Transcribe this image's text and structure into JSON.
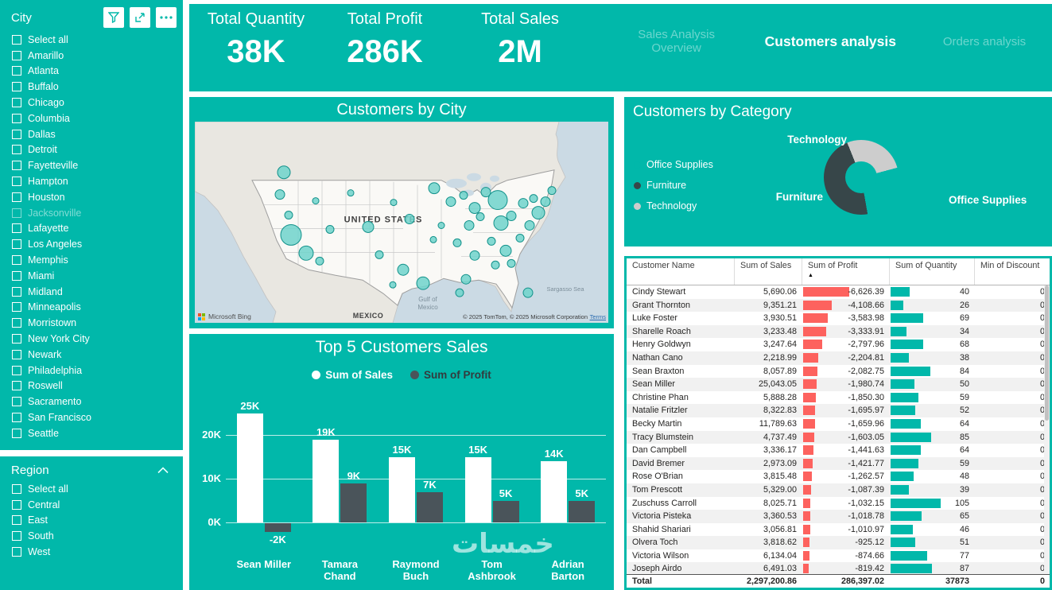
{
  "theme": {
    "teal": "#01B8AA",
    "dark": "#374649",
    "red": "#FD625E",
    "gray_slice": "#CDCDCD",
    "profit_bar": "#4A545A"
  },
  "sidebar": {
    "city": {
      "title": "City",
      "dimmed_item": "Jacksonville",
      "items": [
        "Select all",
        "Amarillo",
        "Atlanta",
        "Buffalo",
        "Chicago",
        "Columbia",
        "Dallas",
        "Detroit",
        "Fayetteville",
        "Hampton",
        "Houston",
        "Jacksonville",
        "Lafayette",
        "Los Angeles",
        "Memphis",
        "Miami",
        "Midland",
        "Minneapolis",
        "Morristown",
        "New York City",
        "Newark",
        "Philadelphia",
        "Roswell",
        "Sacramento",
        "San Francisco",
        "Seattle"
      ]
    },
    "region": {
      "title": "Region",
      "items": [
        "Select all",
        "Central",
        "East",
        "South",
        "West"
      ]
    }
  },
  "header": {
    "kpis": [
      {
        "label": "Total Quantity",
        "value": "38K"
      },
      {
        "label": "Total Profit",
        "value": "286K"
      },
      {
        "label": "Total Sales",
        "value": "2M"
      }
    ],
    "tabs": [
      {
        "label": "Sales Analysis Overview",
        "active": false
      },
      {
        "label": "Customers analysis",
        "active": true
      },
      {
        "label": "Orders analysis",
        "active": false
      }
    ]
  },
  "map": {
    "title": "Customers by City",
    "country_label": "UNITED STATES",
    "mexico_label": "MEXICO",
    "gulf_line1": "Gulf of",
    "gulf_line2": "Mexico",
    "sea_label": "Sargasso Sea",
    "attribution": "© 2025 TomTom, © 2025 Microsoft Corporation",
    "terms": "Terms",
    "bing": "Microsoft Bing",
    "bubbles": [
      [
        112,
        64,
        8
      ],
      [
        107,
        92,
        6
      ],
      [
        121,
        143,
        13
      ],
      [
        140,
        166,
        9
      ],
      [
        157,
        176,
        5
      ],
      [
        118,
        118,
        5
      ],
      [
        170,
        136,
        5
      ],
      [
        152,
        100,
        4
      ],
      [
        196,
        90,
        4
      ],
      [
        218,
        133,
        7
      ],
      [
        232,
        168,
        5
      ],
      [
        250,
        102,
        4
      ],
      [
        270,
        123,
        6
      ],
      [
        262,
        187,
        7
      ],
      [
        287,
        204,
        8
      ],
      [
        249,
        206,
        4
      ],
      [
        301,
        84,
        7
      ],
      [
        322,
        101,
        6
      ],
      [
        338,
        93,
        5
      ],
      [
        352,
        109,
        7
      ],
      [
        366,
        89,
        6
      ],
      [
        345,
        131,
        6
      ],
      [
        330,
        153,
        5
      ],
      [
        352,
        169,
        6
      ],
      [
        373,
        151,
        5
      ],
      [
        391,
        163,
        7
      ],
      [
        378,
        181,
        5
      ],
      [
        341,
        199,
        6
      ],
      [
        398,
        179,
        5
      ],
      [
        409,
        147,
        5
      ],
      [
        421,
        131,
        6
      ],
      [
        432,
        115,
        8
      ],
      [
        413,
        103,
        6
      ],
      [
        398,
        119,
        6
      ],
      [
        385,
        128,
        9
      ],
      [
        381,
        99,
        12
      ],
      [
        426,
        97,
        5
      ],
      [
        441,
        101,
        6
      ],
      [
        449,
        87,
        5
      ],
      [
        419,
        216,
        6
      ],
      [
        333,
        216,
        5
      ],
      [
        300,
        149,
        4
      ],
      [
        359,
        120,
        5
      ],
      [
        310,
        131,
        4
      ]
    ]
  },
  "category": {
    "title": "Customers by Category",
    "legend": [
      {
        "label": "Office Supplies",
        "color": "#01B8AA"
      },
      {
        "label": "Furniture",
        "color": "#374649"
      },
      {
        "label": "Technology",
        "color": "#CDCDCD"
      }
    ],
    "callouts": {
      "top": "Technology",
      "left": "Furniture",
      "right": "Office Supplies"
    },
    "arc_segments": [
      [
        "#CDCDCD",
        0,
        75
      ],
      [
        "#01B8AA",
        75,
        170
      ],
      [
        "#374649",
        170,
        338
      ],
      [
        "#CDCDCD",
        338,
        360
      ]
    ],
    "chart_data": {
      "type": "pie",
      "title": "Customers by Category",
      "categories": [
        "Furniture",
        "Office Supplies",
        "Technology"
      ],
      "values_pct": [
        47,
        26,
        27
      ],
      "colors": [
        "#374649",
        "#01B8AA",
        "#CDCDCD"
      ],
      "legend_position": "left"
    }
  },
  "top5": {
    "title": "Top 5 Customers Sales",
    "category_lines": [
      "Sean Miller",
      "Tamara\nChand",
      "Raymond\nBuch",
      "Tom\nAshbrook",
      "Adrian\nBarton"
    ],
    "chart_data": {
      "type": "bar",
      "title": "Top 5 Customers Sales",
      "categories": [
        "Sean Miller",
        "Tamara Chand",
        "Raymond Buch",
        "Tom Ashbrook",
        "Adrian Barton"
      ],
      "series": [
        {
          "name": "Sum of Sales",
          "color": "#FFFFFF",
          "values": [
            25000,
            19000,
            15000,
            15000,
            14000
          ],
          "labels": [
            "25K",
            "19K",
            "15K",
            "15K",
            "14K"
          ]
        },
        {
          "name": "Sum of Profit",
          "color": "#4A545A",
          "values": [
            -2000,
            9000,
            7000,
            5000,
            5000
          ],
          "labels": [
            "-2K",
            "9K",
            "7K",
            "5K",
            "5K"
          ]
        }
      ],
      "yticks": [
        {
          "label": "20K",
          "value": 20000
        },
        {
          "label": "10K",
          "value": 10000
        },
        {
          "label": "0K",
          "value": 0
        }
      ],
      "ylim": [
        -3000,
        27000
      ],
      "grid": true,
      "legend_position": "top"
    }
  },
  "table": {
    "columns": [
      "Customer Name",
      "Sum of Sales",
      "Sum of Profit",
      "Sum of Quantity",
      "Min of Discount"
    ],
    "sort_column": "Sum of Profit",
    "sort_direction": "ascending",
    "sort_icon": "▲",
    "rows": [
      [
        "Cindy Stewart",
        "5,690.06",
        "-6,626.39",
        "40",
        "0"
      ],
      [
        "Grant Thornton",
        "9,351.21",
        "-4,108.66",
        "26",
        "0"
      ],
      [
        "Luke Foster",
        "3,930.51",
        "-3,583.98",
        "69",
        "0"
      ],
      [
        "Sharelle Roach",
        "3,233.48",
        "-3,333.91",
        "34",
        "0"
      ],
      [
        "Henry Goldwyn",
        "3,247.64",
        "-2,797.96",
        "68",
        "0"
      ],
      [
        "Nathan Cano",
        "2,218.99",
        "-2,204.81",
        "38",
        "0"
      ],
      [
        "Sean Braxton",
        "8,057.89",
        "-2,082.75",
        "84",
        "0"
      ],
      [
        "Sean Miller",
        "25,043.05",
        "-1,980.74",
        "50",
        "0"
      ],
      [
        "Christine Phan",
        "5,888.28",
        "-1,850.30",
        "59",
        "0"
      ],
      [
        "Natalie Fritzler",
        "8,322.83",
        "-1,695.97",
        "52",
        "0"
      ],
      [
        "Becky Martin",
        "11,789.63",
        "-1,659.96",
        "64",
        "0"
      ],
      [
        "Tracy Blumstein",
        "4,737.49",
        "-1,603.05",
        "85",
        "0"
      ],
      [
        "Dan Campbell",
        "3,336.17",
        "-1,441.63",
        "64",
        "0"
      ],
      [
        "David Bremer",
        "2,973.09",
        "-1,421.77",
        "59",
        "0"
      ],
      [
        "Rose O'Brian",
        "3,815.48",
        "-1,262.57",
        "48",
        "0"
      ],
      [
        "Tom Prescott",
        "5,329.00",
        "-1,087.39",
        "39",
        "0"
      ],
      [
        "Zuschuss Carroll",
        "8,025.71",
        "-1,032.15",
        "105",
        "0"
      ],
      [
        "Victoria Pisteka",
        "3,360.53",
        "-1,018.78",
        "65",
        "0"
      ],
      [
        "Shahid Shariari",
        "3,056.81",
        "-1,010.97",
        "46",
        "0"
      ],
      [
        "Olvera Toch",
        "3,818.62",
        "-925.12",
        "51",
        "0"
      ],
      [
        "Victoria Wilson",
        "6,134.04",
        "-874.66",
        "77",
        "0"
      ],
      [
        "Joseph Airdo",
        "6,491.03",
        "-819.42",
        "87",
        "0"
      ]
    ],
    "total": [
      "Total",
      "2,297,200.86",
      "286,397.02",
      "37873",
      "0"
    ]
  },
  "watermark": "خمسات"
}
